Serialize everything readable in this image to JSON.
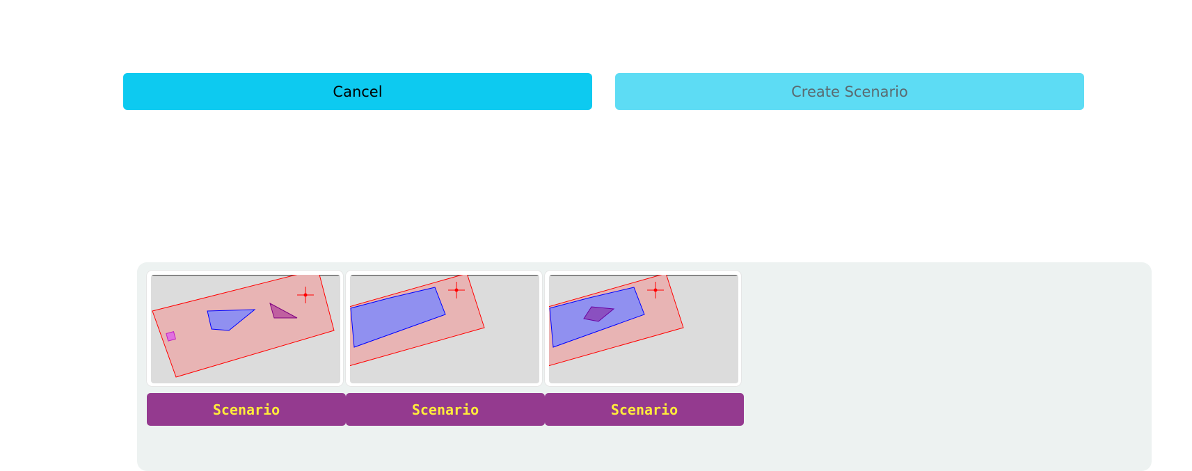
{
  "buttons": {
    "cancel_label": "Cancel",
    "create_label": "Create Scenario"
  },
  "scenarios": [
    {
      "label": "Scenario"
    },
    {
      "label": "Scenario"
    },
    {
      "label": "Scenario"
    }
  ],
  "colors": {
    "cancel_bg": "#0dcaf0",
    "create_bg": "#5ddcf4",
    "panel_bg": "#edf2f1",
    "scenario_bg": "#943a8f",
    "scenario_text": "#ffeb3b",
    "zone_fill": "#e8b4b4",
    "zone_stroke": "#ff0000",
    "shape_fill": "#9090f0",
    "shape_stroke": "#0000ff",
    "purple_fill": "#c060a0",
    "magenta_fill": "#e070e0"
  }
}
